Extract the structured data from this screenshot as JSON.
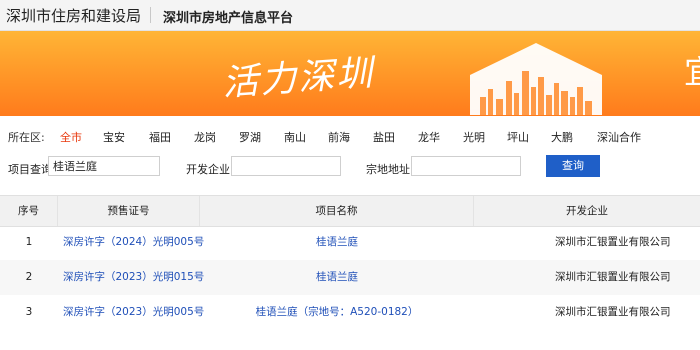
{
  "header": {
    "bureau": "深圳市住房和建设局",
    "platform": "深圳市房地产信息平台"
  },
  "banner": {
    "slogan": "活力深圳",
    "edge_char": "宜"
  },
  "district_filter": {
    "label": "所在区:",
    "items": [
      "全市",
      "宝安",
      "福田",
      "龙岗",
      "罗湖",
      "南山",
      "前海",
      "盐田",
      "龙华",
      "光明",
      "坪山",
      "大鹏",
      "深汕合作"
    ],
    "active": "全市"
  },
  "search": {
    "project_label": "项目查询",
    "project_value": "桂语兰庭",
    "developer_label": "开发企业",
    "developer_value": "",
    "address_label": "宗地地址",
    "address_value": "",
    "button_label": "查询"
  },
  "table": {
    "headers": [
      "序号",
      "预售证号",
      "项目名称",
      "开发企业"
    ],
    "rows": [
      {
        "index": "1",
        "permit": "深房许字（2024）光明005号",
        "project": "桂语兰庭",
        "developer": "深圳市汇银置业有限公司"
      },
      {
        "index": "2",
        "permit": "深房许字（2023）光明015号",
        "project": "桂语兰庭",
        "developer": "深圳市汇银置业有限公司"
      },
      {
        "index": "3",
        "permit": "深房许字（2023）光明005号",
        "project": "桂语兰庭（宗地号：A520-0182）",
        "developer": "深圳市汇银置业有限公司"
      }
    ]
  },
  "colors": {
    "accent": "#1f5fc8",
    "active_district": "#e8380d",
    "banner": "#ff9527",
    "link": "#1f4fb8"
  }
}
